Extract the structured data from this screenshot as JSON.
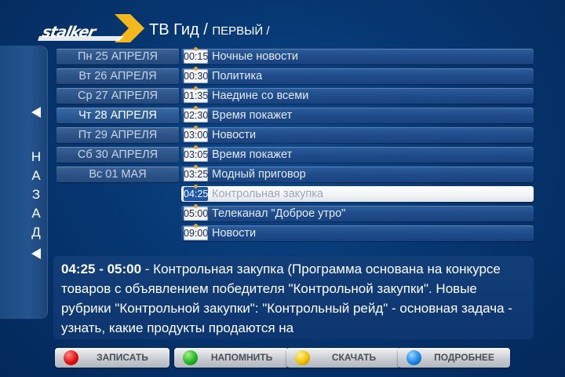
{
  "header": {
    "logo_text": "stalker",
    "title": "ТВ Гид /",
    "channel": "ПЕРВЫЙ /"
  },
  "back_panel": {
    "label": [
      "Н",
      "А",
      "З",
      "А",
      "Д"
    ]
  },
  "days": [
    {
      "label": "Пн 25 АПРЕЛЯ"
    },
    {
      "label": "Вт 26 АПРЕЛЯ"
    },
    {
      "label": "Ср 27 АПРЕЛЯ"
    },
    {
      "label": "Чт 28 АПРЕЛЯ"
    },
    {
      "label": "Пт 29 АПРЕЛЯ"
    },
    {
      "label": "Сб 30 АПРЕЛЯ"
    },
    {
      "label": "Вс 01 МАЯ"
    }
  ],
  "active_day_index": 3,
  "programs": [
    {
      "time": "00:15",
      "title": "Ночные новости"
    },
    {
      "time": "00:30",
      "title": "Политика"
    },
    {
      "time": "01:35",
      "title": "Наедине со всеми"
    },
    {
      "time": "02:30",
      "title": "Время покажет"
    },
    {
      "time": "03:00",
      "title": "Новости"
    },
    {
      "time": "03:05",
      "title": "Время покажет"
    },
    {
      "time": "03:25",
      "title": "Модный приговор"
    },
    {
      "time": "04:25",
      "title": "Контрольная закупка"
    },
    {
      "time": "05:00",
      "title": "Телеканал \"Доброе утро\""
    },
    {
      "time": "09:00",
      "title": "Новости"
    }
  ],
  "selected_program_index": 7,
  "description": {
    "range": "04:25 - 05:00",
    "text": " - Контрольная закупка (Программа основана на конкурсе товаров с объявлением победителя \"Контрольной закупки\". Новые рубрики \"Контрольной закупки\": \"Контрольный рейд\" - основная задача - узнать, какие продукты продаются на"
  },
  "buttons": {
    "record": {
      "label": "ЗАПИСАТЬ",
      "color": "red"
    },
    "remind": {
      "label": "НАПОМНИТЬ",
      "color": "green"
    },
    "download": {
      "label": "СКАЧАТЬ",
      "color": "yellow"
    },
    "details": {
      "label": "ПОДРОБНЕЕ",
      "color": "blue"
    }
  },
  "colors": {
    "background": "#063772",
    "selected_row": "#ffffff",
    "accent_logo": "#f4b81c"
  }
}
